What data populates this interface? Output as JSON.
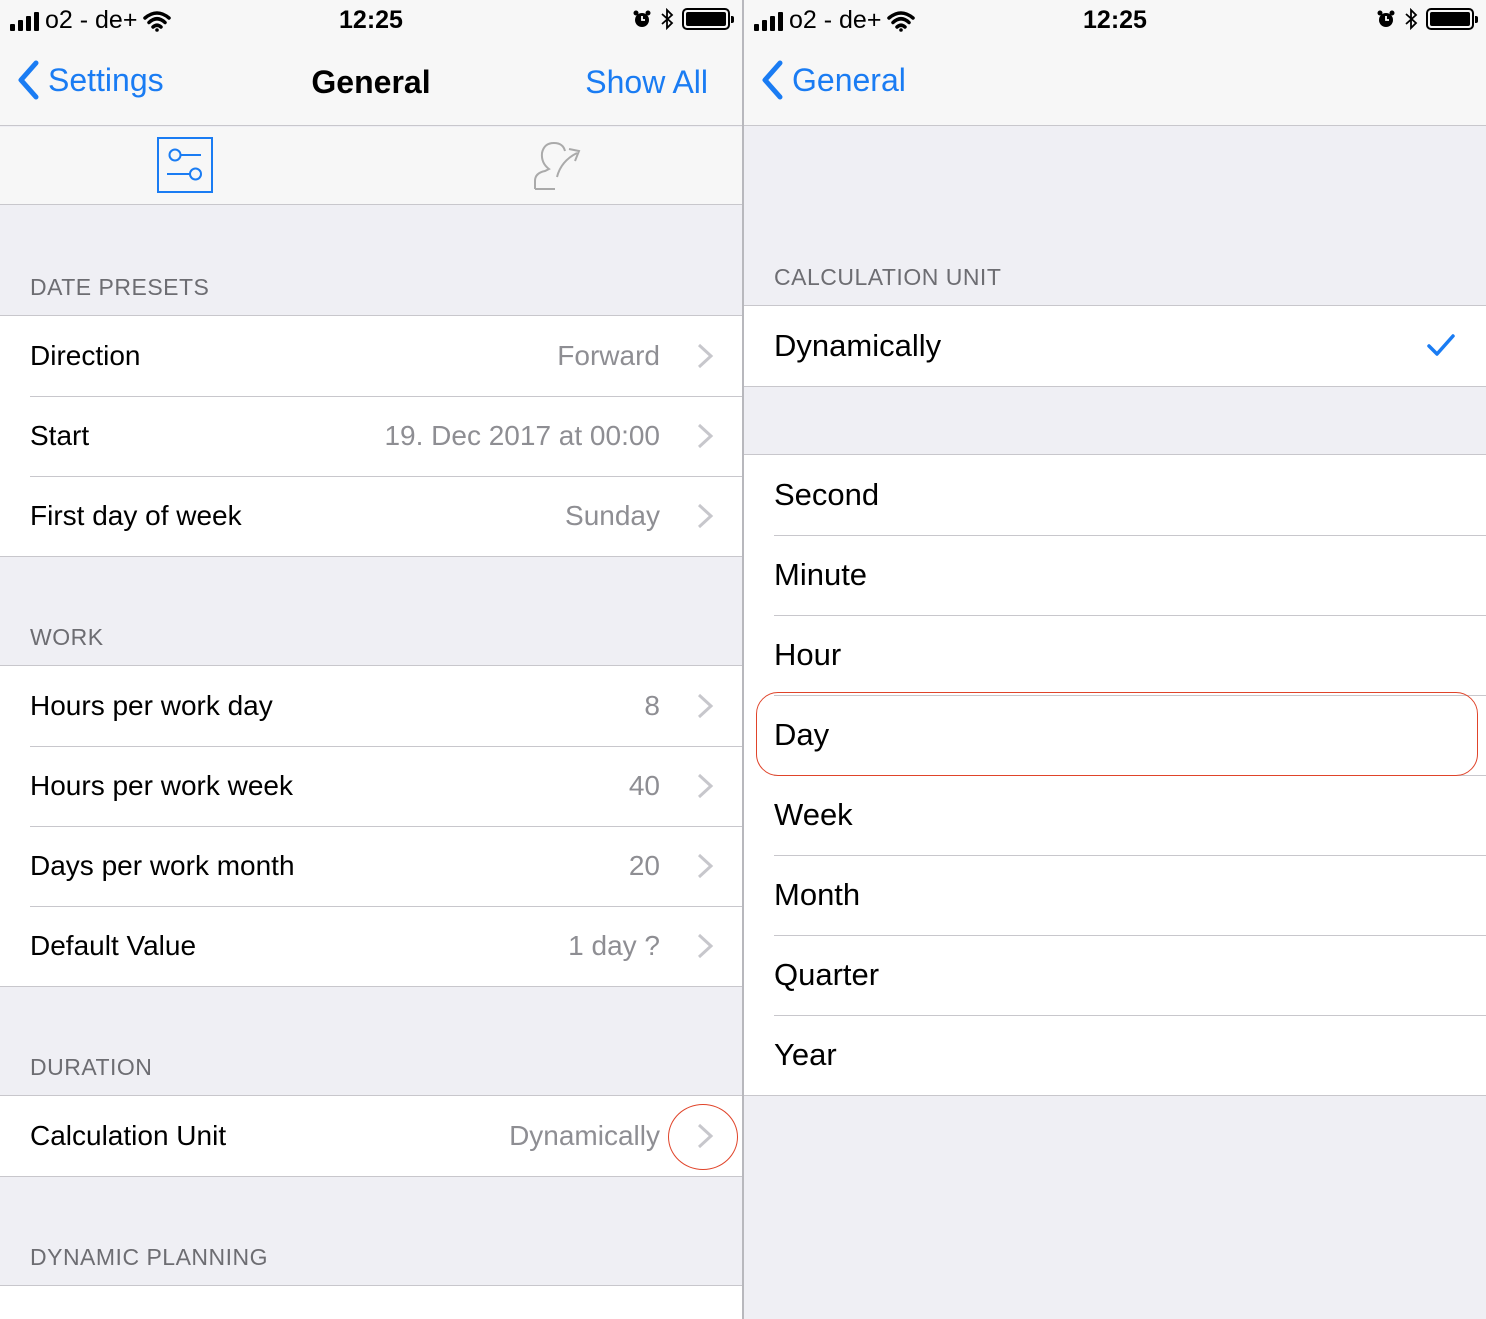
{
  "status_bar": {
    "carrier": "o2 - de+",
    "time": "12:25"
  },
  "left_screen": {
    "nav": {
      "back_label": "Settings",
      "title": "General",
      "right_action": "Show All"
    },
    "tab_icons": [
      "settings-sliders-icon",
      "share-user-icon"
    ],
    "sections": {
      "date_presets": {
        "header": "DATE PRESETS",
        "rows": [
          {
            "label": "Direction",
            "value": "Forward"
          },
          {
            "label": "Start",
            "value": "19. Dec 2017 at 00:00"
          },
          {
            "label": "First day of week",
            "value": "Sunday"
          }
        ]
      },
      "work": {
        "header": "WORK",
        "rows": [
          {
            "label": "Hours per work day",
            "value": "8"
          },
          {
            "label": "Hours per work week",
            "value": "40"
          },
          {
            "label": "Days per work month",
            "value": "20"
          },
          {
            "label": "Default Value",
            "value": "1 day ?"
          }
        ]
      },
      "duration": {
        "header": "DURATION",
        "rows": [
          {
            "label": "Calculation Unit",
            "value": "Dynamically"
          }
        ]
      },
      "dynamic_planning": {
        "header": "DYNAMIC PLANNING"
      }
    }
  },
  "right_screen": {
    "nav": {
      "back_label": "General"
    },
    "header": "CALCULATION UNIT",
    "top_option": {
      "label": "Dynamically",
      "selected": true
    },
    "options": [
      "Second",
      "Minute",
      "Hour",
      "Day",
      "Week",
      "Month",
      "Quarter",
      "Year"
    ]
  },
  "colors": {
    "accent": "#1a7cf3",
    "annotation": "#e0442a",
    "group_bg": "#efeff4"
  }
}
